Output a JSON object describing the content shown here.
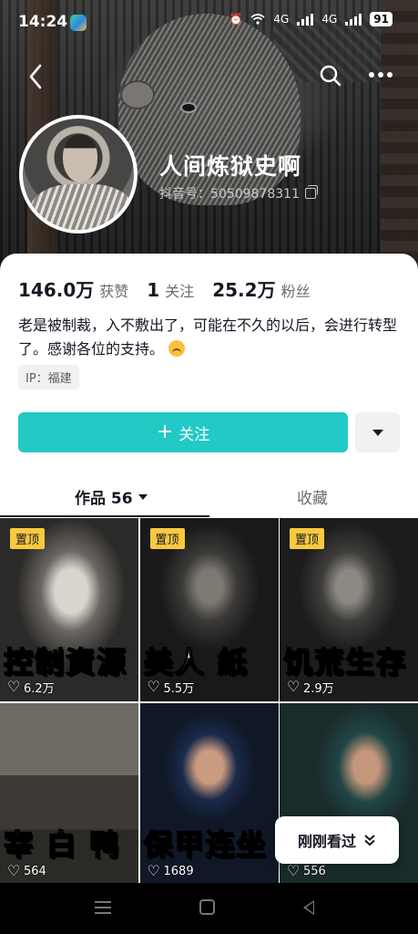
{
  "status_bar": {
    "time": "14:24",
    "network_1": "4G",
    "network_2": "4G",
    "battery": "91"
  },
  "profile": {
    "username": "人间炼狱史啊",
    "douyin_id": "抖音号：50509878311",
    "bio": "老是被制裁，入不敷出了，可能在不久的以后，会进行转型了。感谢各位的支持。",
    "ip_location": "IP：福建"
  },
  "stats": [
    {
      "value": "146.0万",
      "label": "获赞"
    },
    {
      "value": "1",
      "label": "关注"
    },
    {
      "value": "25.2万",
      "label": "粉丝"
    }
  ],
  "actions": {
    "follow_label": "关注"
  },
  "tabs": {
    "works_label": "作品 56",
    "favorites_label": "收藏"
  },
  "videos": [
    {
      "pinned": "置顶",
      "caption": "控制資源",
      "likes": "6.2万"
    },
    {
      "pinned": "置顶",
      "caption": "美人 紙",
      "likes": "5.5万"
    },
    {
      "pinned": "置顶",
      "caption": "饥荒生存",
      "likes": "2.9万"
    },
    {
      "caption": "宰 白 鸭",
      "likes": "564"
    },
    {
      "caption": "保甲连坐",
      "likes": "1689"
    },
    {
      "caption": "",
      "likes": "556"
    }
  ],
  "floating": {
    "just_watched": "刚刚看过"
  },
  "colors": {
    "accent": "#22c9c5",
    "pin_badge": "#f9c93e",
    "text_primary": "#161823"
  }
}
